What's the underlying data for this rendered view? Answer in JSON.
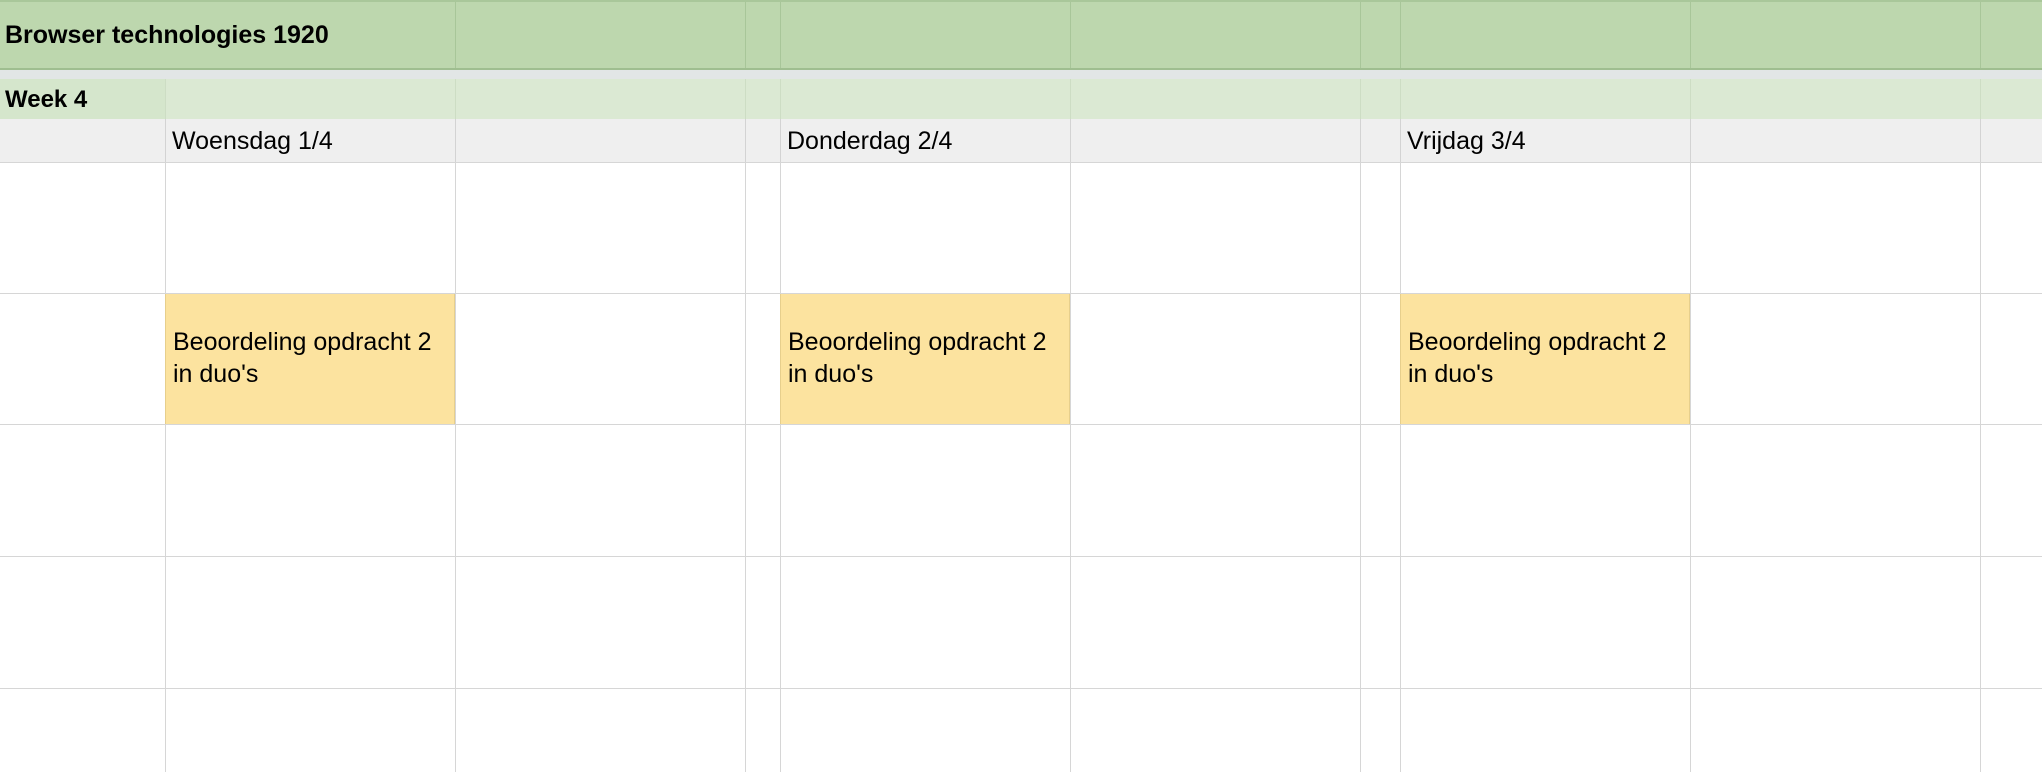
{
  "sheet": {
    "title": "Browser technologies 1920",
    "week_label": "Week 4",
    "days": [
      {
        "label": "Woensdag 1/4",
        "event": "Beoordeling opdracht 2 in duo's"
      },
      {
        "label": "Donderdag 2/4",
        "event": "Beoordeling opdracht 2 in duo's"
      },
      {
        "label": "Vrijdag 3/4",
        "event": "Beoordeling opdracht 2 in duo's"
      }
    ]
  },
  "colors": {
    "title_band": "#bdd7ae",
    "week_band": "#dbe9d3",
    "day_header": "#efefef",
    "event_fill": "#fce39f",
    "gridline": "#d6d6d6"
  }
}
